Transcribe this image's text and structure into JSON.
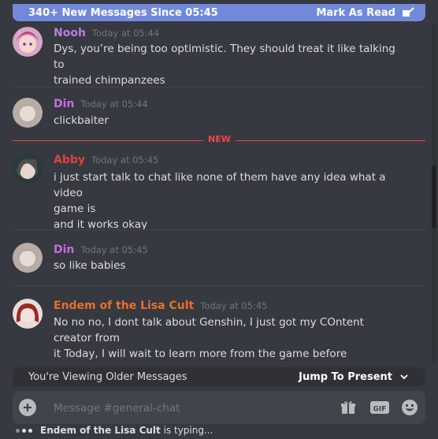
{
  "banner": {
    "text": "340+ New Messages Since 05:45",
    "action": "Mark As Read"
  },
  "messages": [
    {
      "author": "Nooh",
      "color": "#b97fe0",
      "time": "Today at 05:44",
      "lines": [
        "Dys, you’re being too optimistic. They should treat it like talking to",
        "trained chimpanzees"
      ]
    },
    {
      "author": "Din",
      "color": "#c86be0",
      "time": "Today at 05:44",
      "lines": [
        "clickbaiter"
      ]
    },
    {
      "author": "Abby",
      "color": "#e0423a",
      "time": "Today at 05:45",
      "lines": [
        "i just start talk to chat like none of them have any idea what a video",
        "game is",
        "and it works okay"
      ]
    },
    {
      "author": "Din",
      "color": "#c86be0",
      "time": "Today at 05:45",
      "lines": [
        "so like babies"
      ]
    },
    {
      "author": "Endem of the Lisa Cult",
      "color": "#e8702a",
      "time": "Today at 05:45",
      "lines": [
        "No no no, I dont talk about Genshin, I just got my COntent creator from",
        "it Today, I will wait to learn more from the game before"
      ]
    }
  ],
  "new_divider": "NEW",
  "older_bar": {
    "text": "You're Viewing Older Messages",
    "action": "Jump To Present"
  },
  "composer": {
    "placeholder": "Message #general-chat",
    "value": ""
  },
  "typing": {
    "user": "Endem of the Lisa Cult",
    "suffix": " is typing..."
  }
}
